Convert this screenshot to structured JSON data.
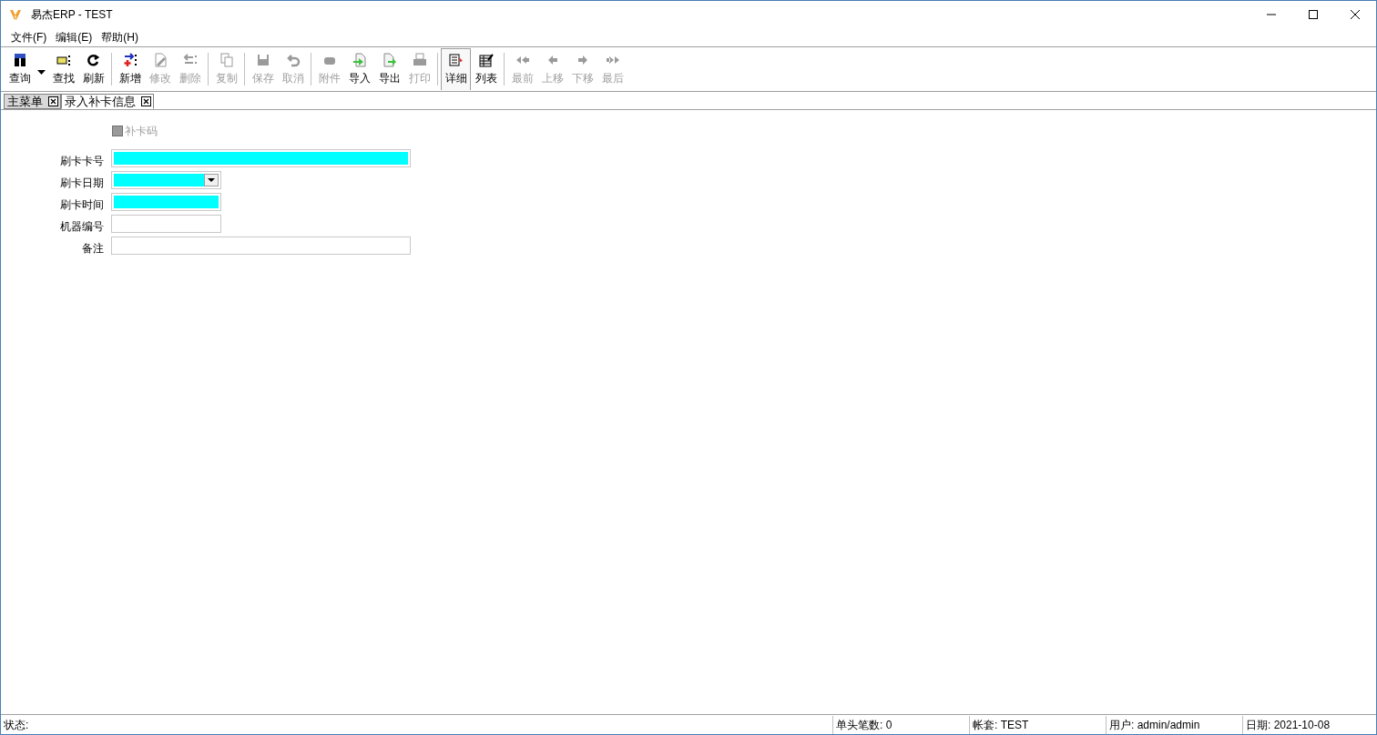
{
  "window": {
    "title": "易杰ERP - TEST"
  },
  "menu": [
    "文件(F)",
    "编辑(E)",
    "帮助(H)"
  ],
  "toolbar": [
    [
      {
        "label": "查询",
        "disabled": false,
        "selected": false,
        "dropdown": true
      },
      {
        "label": "查找",
        "disabled": false,
        "selected": false
      },
      {
        "label": "刷新",
        "disabled": false,
        "selected": false
      }
    ],
    [
      {
        "label": "新增",
        "disabled": false,
        "selected": false
      },
      {
        "label": "修改",
        "disabled": true,
        "selected": false
      },
      {
        "label": "删除",
        "disabled": true,
        "selected": false
      }
    ],
    [
      {
        "label": "复制",
        "disabled": true,
        "selected": false
      }
    ],
    [
      {
        "label": "保存",
        "disabled": true,
        "selected": false
      },
      {
        "label": "取消",
        "disabled": true,
        "selected": false
      }
    ],
    [
      {
        "label": "附件",
        "disabled": true,
        "selected": false
      },
      {
        "label": "导入",
        "disabled": false,
        "selected": false
      },
      {
        "label": "导出",
        "disabled": false,
        "selected": false
      },
      {
        "label": "打印",
        "disabled": true,
        "selected": false
      }
    ],
    [
      {
        "label": "详细",
        "disabled": false,
        "selected": true
      },
      {
        "label": "列表",
        "disabled": false,
        "selected": false
      }
    ],
    [
      {
        "label": "最前",
        "disabled": true,
        "selected": false
      },
      {
        "label": "上移",
        "disabled": true,
        "selected": false
      },
      {
        "label": "下移",
        "disabled": true,
        "selected": false
      },
      {
        "label": "最后",
        "disabled": true,
        "selected": false
      }
    ]
  ],
  "tabs": [
    {
      "label": "主菜单",
      "selected": false
    },
    {
      "label": "录入补卡信息",
      "selected": true
    }
  ],
  "form": {
    "checkbox": {
      "label": "补卡码",
      "disabled": true,
      "checked": false
    },
    "fields": [
      {
        "label": "刷卡卡号",
        "kind": "text",
        "required": true
      },
      {
        "label": "刷卡日期",
        "kind": "date",
        "required": true
      },
      {
        "label": "刷卡时间",
        "kind": "text",
        "required": true
      },
      {
        "label": "机器编号",
        "kind": "text",
        "required": false
      },
      {
        "label": "备注",
        "kind": "text",
        "required": false
      }
    ]
  },
  "status_bar": {
    "label": "状态:",
    "sections": [
      "单头笔数: 0",
      "帐套: TEST",
      "用户: admin/admin",
      "日期: 2021-10-08"
    ]
  }
}
